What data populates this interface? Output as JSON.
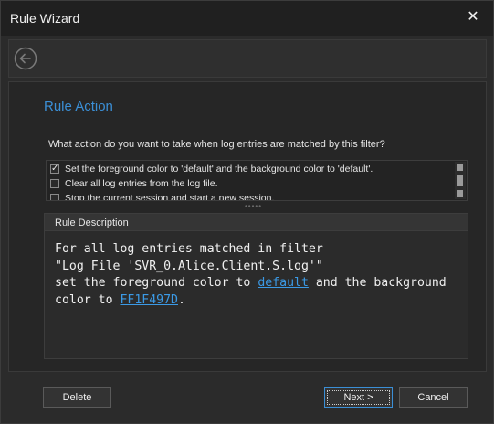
{
  "window": {
    "title": "Rule Wizard"
  },
  "icons": {
    "close": "close-icon",
    "back": "back-arrow-icon",
    "checkmark": "checkmark-icon"
  },
  "page": {
    "heading": "Rule Action",
    "question": "What action do you want to take when log entries are matched by this filter?"
  },
  "actions": [
    {
      "label": "Set the foreground color to 'default' and the background color to 'default'.",
      "checked": true
    },
    {
      "label": "Clear all log entries from the log file.",
      "checked": false
    },
    {
      "label": "Stop the current session and start a new session.",
      "checked": false
    }
  ],
  "description": {
    "header": "Rule Description",
    "line1": "For all log entries matched in filter",
    "line2": "\"Log File 'SVR_0.Alice.Client.S.log'\"",
    "line3_prefix": "set the foreground color to ",
    "line3_link": "default",
    "line3_suffix": " and the background",
    "line4_prefix": "color to ",
    "line4_link": "FF1F497D",
    "line4_suffix": "."
  },
  "buttons": {
    "delete": "Delete",
    "next": "Next >",
    "cancel": "Cancel"
  },
  "colors": {
    "accent": "#3b8fd6",
    "link": "#3b9ae6",
    "background": "#2b2b2b"
  }
}
